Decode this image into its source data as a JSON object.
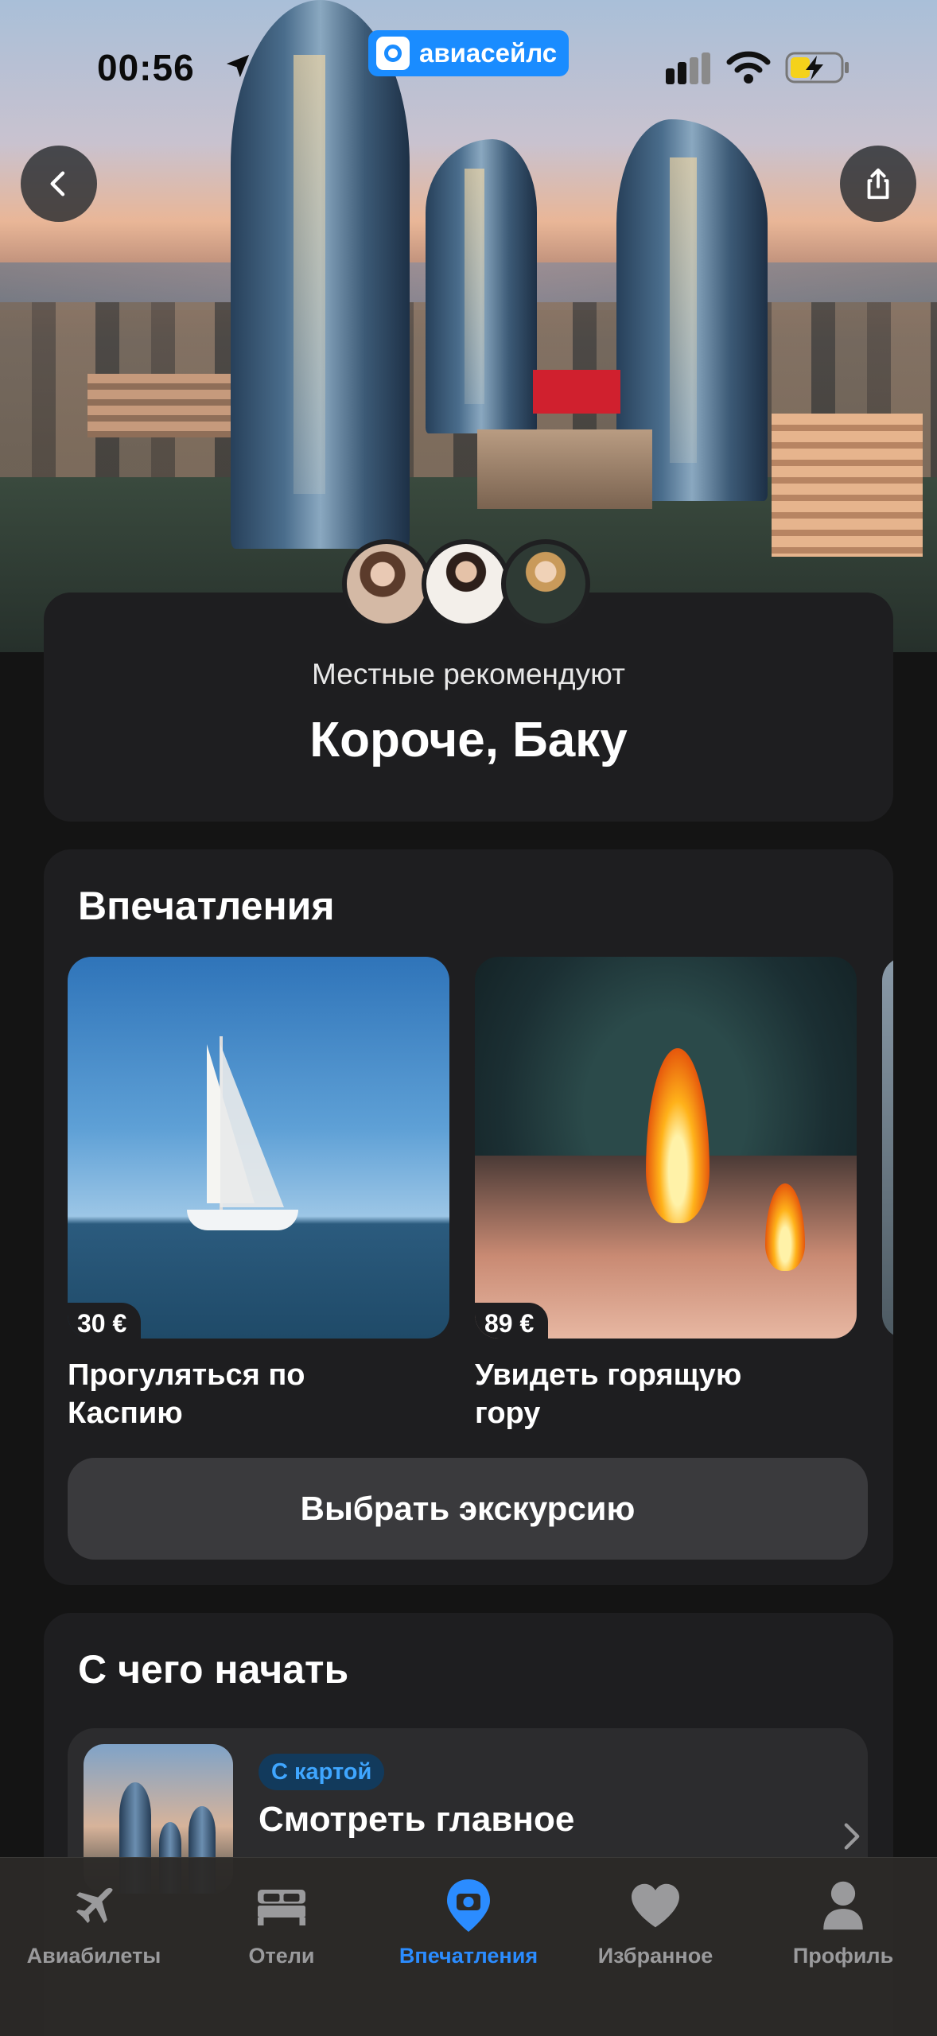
{
  "status_bar": {
    "time": "00:56"
  },
  "brand": {
    "name": "авиасейлс"
  },
  "hero": {
    "back_icon": "chevron-left-icon",
    "share_icon": "share-icon"
  },
  "intro": {
    "subtitle": "Местные рекомендуют",
    "title": "Короче, Баку"
  },
  "experiences": {
    "title": "Впечатления",
    "items": [
      {
        "price": "30 €",
        "title": "Прогуляться по Каспию"
      },
      {
        "price": "89 €",
        "title": "Увидеть горящую гору"
      }
    ],
    "cta_label": "Выбрать экскурсию"
  },
  "start": {
    "title": "С чего начать",
    "items": [
      {
        "chip": "С картой",
        "title": "Смотреть главное"
      }
    ]
  },
  "tabbar": {
    "tabs": [
      {
        "label": "Авиабилеты",
        "icon": "plane-icon",
        "active": false
      },
      {
        "label": "Отели",
        "icon": "bed-icon",
        "active": false
      },
      {
        "label": "Впечатления",
        "icon": "camera-pin-icon",
        "active": true
      },
      {
        "label": "Избранное",
        "icon": "heart-icon",
        "active": false
      },
      {
        "label": "Профиль",
        "icon": "person-icon",
        "active": false
      }
    ]
  },
  "colors": {
    "accent": "#2b8cff",
    "brand": "#1a8cff",
    "card": "#1e1e20",
    "background": "#141414"
  }
}
